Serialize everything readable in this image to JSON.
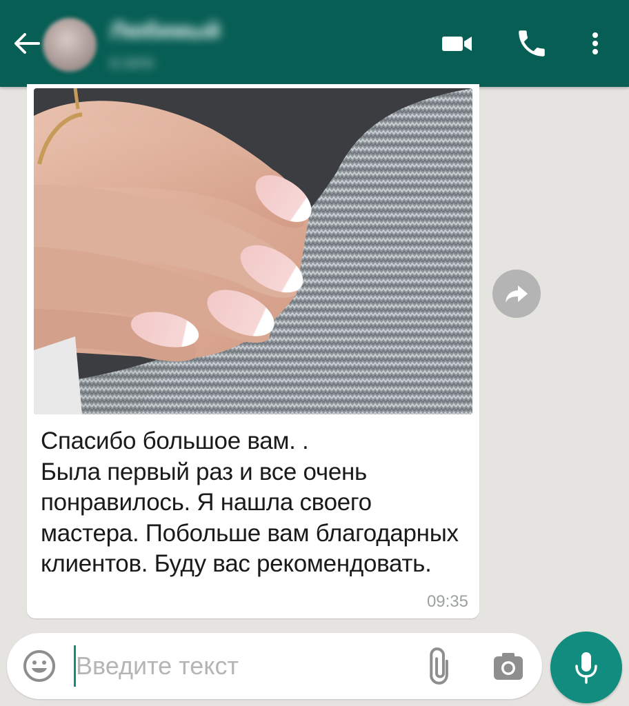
{
  "header": {
    "contact_name": "Любимый",
    "contact_status": "в сети",
    "accent_color": "#075e54"
  },
  "icons": {
    "back": "arrow-left-icon",
    "video": "video-camera-icon",
    "call": "phone-icon",
    "more": "more-vert-icon",
    "forward": "forward-icon",
    "emoji": "smiley-icon",
    "attach": "paperclip-icon",
    "camera": "camera-icon",
    "mic": "microphone-icon"
  },
  "message": {
    "text": "Спасибо большое вам. .\nБыла первый раз и все очень понравилось. Я нашла своего мастера. Побольше вам благодарных клиентов. Буду вас рекомендовать.",
    "time": "09:35"
  },
  "input": {
    "placeholder": "Введите текст",
    "value": ""
  }
}
